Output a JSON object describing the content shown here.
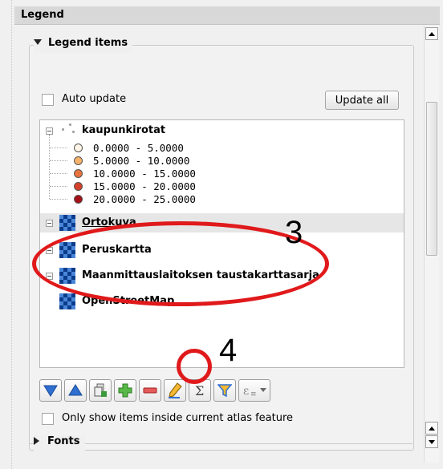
{
  "panel": {
    "title": "Legend"
  },
  "legend_items": {
    "header": "Legend items",
    "auto_update_label": "Auto update",
    "update_all_label": "Update all",
    "atlas_filter_label": "Only show items inside current atlas feature"
  },
  "tree": {
    "layers": [
      {
        "name": "kaupunkirotat",
        "type": "point",
        "classes": [
          {
            "label": "0.0000 - 5.0000",
            "color": "#fff5e6"
          },
          {
            "label": "5.0000 - 10.0000",
            "color": "#f4b26a"
          },
          {
            "label": "10.0000 - 15.0000",
            "color": "#e8723c"
          },
          {
            "label": "15.0000 - 20.0000",
            "color": "#d4402a"
          },
          {
            "label": "20.0000 - 25.0000",
            "color": "#a50f15"
          }
        ]
      },
      {
        "name": "Ortokuva",
        "type": "raster",
        "selected": true
      },
      {
        "name": "Peruskartta",
        "type": "raster"
      },
      {
        "name": "Maanmittauslaitoksen taustakarttasarja",
        "type": "raster"
      },
      {
        "name": "OpenStreetMap",
        "type": "raster"
      }
    ]
  },
  "toolbar": {
    "buttons": [
      {
        "name": "move-down",
        "icon": "triangle-down-icon"
      },
      {
        "name": "move-up",
        "icon": "triangle-up-icon"
      },
      {
        "name": "add-group",
        "icon": "add-group-icon"
      },
      {
        "name": "add-item",
        "icon": "plus-icon"
      },
      {
        "name": "remove-item",
        "icon": "minus-icon"
      },
      {
        "name": "edit-item",
        "icon": "pencil-icon"
      },
      {
        "name": "count-features",
        "icon": "sigma-icon"
      },
      {
        "name": "filter-legend",
        "icon": "filter-icon"
      },
      {
        "name": "filter-expression",
        "icon": "expression-icon"
      }
    ]
  },
  "fonts_section": {
    "header": "Fonts"
  },
  "annotations": {
    "layers_callout": "3",
    "remove_callout": "4",
    "color": "#e0191b"
  }
}
